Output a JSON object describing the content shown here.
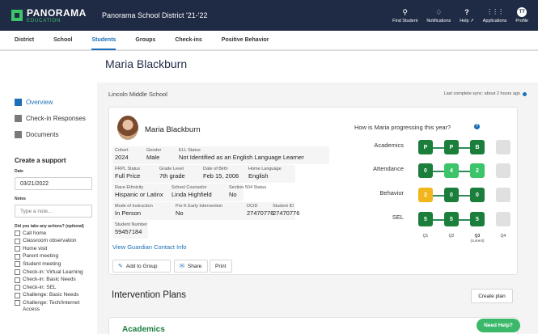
{
  "topbar": {
    "logo_main": "PANORAMA",
    "logo_sub": "EDUCATION",
    "district": "Panorama School District '21-'22",
    "actions": [
      {
        "label": "Find Student",
        "icon": "search-icon",
        "glyph": "⚲"
      },
      {
        "label": "Notifications",
        "icon": "bell-icon",
        "glyph": "🔔"
      },
      {
        "label": "Help ↗",
        "icon": "help-icon",
        "glyph": "?"
      },
      {
        "label": "Applications",
        "icon": "grid-icon",
        "glyph": "⋮⋮⋮"
      },
      {
        "label": "Profile",
        "icon": "avatar-icon",
        "glyph": "TT"
      }
    ]
  },
  "subnav": {
    "items": [
      "District",
      "School",
      "Students",
      "Groups",
      "Check-ins",
      "Positive Behavior"
    ],
    "active": "Students"
  },
  "student": {
    "name": "Maria Blackburn"
  },
  "sidebar": {
    "nav": [
      {
        "label": "Overview",
        "icon": "overview-icon"
      },
      {
        "label": "Check-in Responses",
        "icon": "checkin-icon"
      },
      {
        "label": "Documents",
        "icon": "documents-icon"
      }
    ],
    "support_title": "Create a support",
    "date_label": "Date",
    "date_value": "03/21/2022",
    "notes_label": "Notes",
    "notes_placeholder": "Type a note...",
    "actions_label": "Did you take any actions? (optional)",
    "actions": [
      "Call home",
      "Classroom observation",
      "Home visit",
      "Parent meeting",
      "Student meeting",
      "Check-in: Virtual Learning",
      "Check-in: Basic Needs",
      "Check-in: SEL",
      "Challenge: Basic Needs",
      "Challenge: Tech/Internet Access"
    ]
  },
  "main": {
    "school": "Lincoln Middle School",
    "sync": "Last complete sync: about 2 hours ago"
  },
  "card": {
    "name": "Maria Blackburn",
    "fields": {
      "cohort": {
        "label": "Cohort",
        "value": "2024"
      },
      "gender": {
        "label": "Gender",
        "value": "Male"
      },
      "ell": {
        "label": "ELL Status",
        "value": "Not Identified as an English Language Learner"
      },
      "frpl": {
        "label": "FRPL Status",
        "value": "Full Price"
      },
      "grade": {
        "label": "Grade Level",
        "value": "7th grade"
      },
      "dob": {
        "label": "Date of Birth",
        "value": "Feb 15, 2006"
      },
      "language": {
        "label": "Home Language",
        "value": "English"
      },
      "race": {
        "label": "Race Ethnicity",
        "value": "Hispanic or Latinx"
      },
      "counselor": {
        "label": "School Counselor",
        "value": "Linda Highfield"
      },
      "s504": {
        "label": "Section 504 Status",
        "value": "No"
      },
      "mode": {
        "label": "Mode of Instruction",
        "value": "In Person"
      },
      "prek": {
        "label": "Pre K Early Intervention",
        "value": "No"
      },
      "dcid": {
        "label": "DCID",
        "value": "27470776"
      },
      "sid": {
        "label": "Student ID",
        "value": "27470776"
      },
      "snum": {
        "label": "Student Number",
        "value": "59457184"
      }
    },
    "guardian_link": "View Guardian Contact Info",
    "buttons": {
      "add_group": "Add to Group",
      "share": "Share",
      "print": "Print"
    }
  },
  "progress": {
    "title": "How is Maria progressing this year?",
    "quarters": [
      "Q1",
      "Q2",
      "Q3",
      "Q4"
    ],
    "current_label": "(current)",
    "rows": [
      {
        "label": "Academics",
        "cells": [
          {
            "text": "P",
            "color": "#1b7f3b"
          },
          {
            "text": "P",
            "color": "#1b7f3b"
          },
          {
            "text": "B",
            "color": "#1b7f3b"
          },
          {
            "text": "",
            "color": "#e0e0e0"
          }
        ]
      },
      {
        "label": "Attendance",
        "cells": [
          {
            "text": "0",
            "color": "#1b7f3b"
          },
          {
            "text": "4",
            "color": "#3cc46a"
          },
          {
            "text": "2",
            "color": "#3cc46a"
          },
          {
            "text": "",
            "color": "#e0e0e0"
          }
        ]
      },
      {
        "label": "Behavior",
        "cells": [
          {
            "text": "2",
            "color": "#f2b51c"
          },
          {
            "text": "0",
            "color": "#1b7f3b"
          },
          {
            "text": "0",
            "color": "#1b7f3b"
          },
          {
            "text": "",
            "color": "#e0e0e0"
          }
        ]
      },
      {
        "label": "SEL",
        "cells": [
          {
            "text": "5",
            "color": "#1b7f3b"
          },
          {
            "text": "5",
            "color": "#1b7f3b"
          },
          {
            "text": "5",
            "color": "#1b7f3b"
          },
          {
            "text": "",
            "color": "#e0e0e0"
          }
        ]
      }
    ]
  },
  "interventions": {
    "title": "Intervention Plans",
    "create_label": "Create plan",
    "first_section": "Academics"
  },
  "help_button": "Need Help?"
}
